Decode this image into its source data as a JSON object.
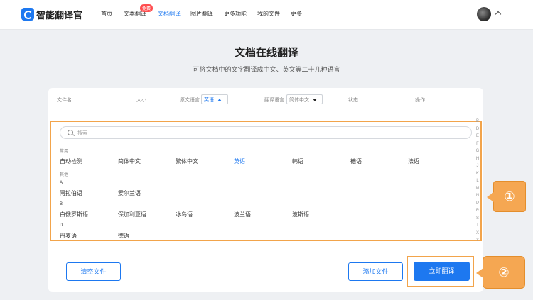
{
  "brand": {
    "name": "智能翻译官"
  },
  "nav": {
    "items": [
      "首页",
      "文本翻译",
      "文档翻译",
      "图片翻译",
      "更多功能",
      "我的文件",
      "更多"
    ],
    "badge": "免费"
  },
  "header": {
    "title": "文档在线翻译",
    "subtitle": "可将文档中的文字翻译成中文、英文等二十几种语言"
  },
  "table": {
    "col_filename": "文件名",
    "col_size": "大小",
    "col_source": "原文语言",
    "source_value": "英语",
    "col_target": "翻译语言",
    "target_value": "简体中文",
    "col_status": "状态",
    "col_action": "操作"
  },
  "picker": {
    "search_placeholder": "搜索",
    "common_label": "常用",
    "common": [
      "自动检测",
      "简体中文",
      "繁体中文",
      "英语",
      "韩语",
      "德语",
      "法语"
    ],
    "selected": "英语",
    "other_label": "其他",
    "groups": [
      {
        "letter": "A",
        "langs": [
          "阿拉伯语",
          "爱尔兰语"
        ]
      },
      {
        "letter": "B",
        "langs": [
          "白俄罗斯语",
          "保加利亚语",
          "冰岛语",
          "波兰语",
          "波斯语"
        ]
      },
      {
        "letter": "D",
        "langs": [
          "丹麦语",
          "德语"
        ]
      }
    ],
    "alphabet": [
      "B",
      "D",
      "E",
      "F",
      "G",
      "H",
      "J",
      "K",
      "L",
      "M",
      "N",
      "P",
      "R",
      "S",
      "T",
      "X",
      "Y"
    ]
  },
  "actions": {
    "clear": "清空文件",
    "add": "添加文件",
    "translate": "立即翻译"
  },
  "callouts": {
    "one": "①",
    "two": "②"
  },
  "colors": {
    "accent": "#1d78f0",
    "highlight": "#f2a44b"
  }
}
